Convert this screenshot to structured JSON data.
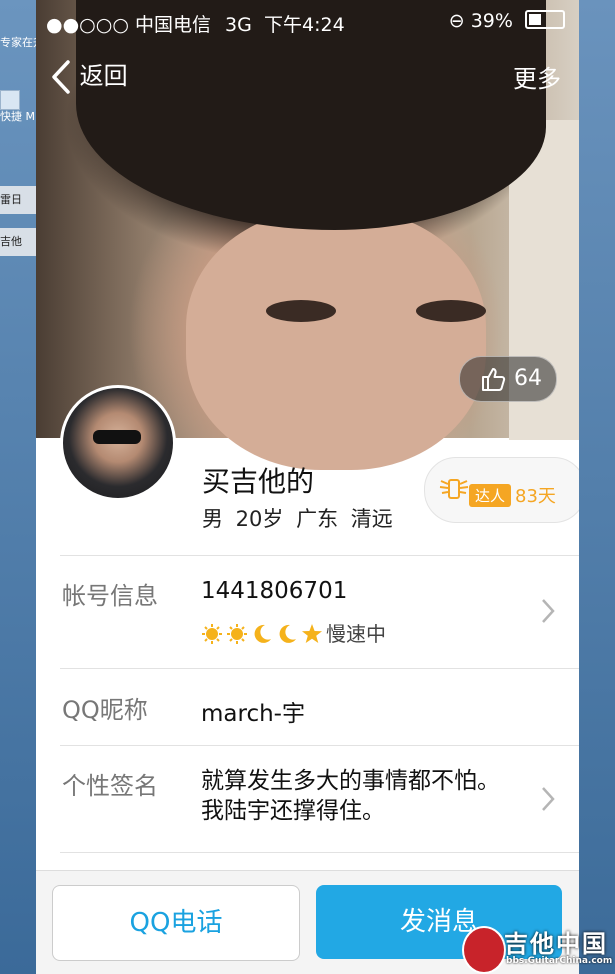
{
  "desktop": {
    "icons": [
      {
        "label": "专家在升级"
      },
      {
        "label": "快捷 Microsof..."
      }
    ],
    "taskbar": [
      {
        "label": "雷日"
      },
      {
        "label": "吉他"
      }
    ]
  },
  "status_bar": {
    "signal": "●●○○○",
    "carrier": "中国电信",
    "network": "3G",
    "time": "下午4:24",
    "battery_percent": "39%",
    "battery_level": 0.39
  },
  "nav": {
    "back_label": "返回",
    "more_label": "更多"
  },
  "profile": {
    "likes": "64",
    "name": "买吉他的",
    "info": "男  20岁  广东 清远",
    "daren_badge": "达人",
    "daren_days": "83天"
  },
  "rows": {
    "account": {
      "label": "帐号信息",
      "value": "1441806701",
      "level_icons": [
        "sun-icon",
        "sun-icon",
        "moon-icon",
        "moon-icon",
        "star-icon"
      ],
      "speed": "慢速中"
    },
    "nickname": {
      "label": "QQ昵称",
      "value": "march-宇"
    },
    "signature": {
      "label": "个性签名",
      "value": "就算发生多大的事情都不怕。我陆宇还撑得住。"
    }
  },
  "actions": {
    "call_label": "QQ电话",
    "message_label": "发消息"
  },
  "watermark": {
    "title": "吉他中国",
    "url": "bbs.GuitarChina.com"
  },
  "colors": {
    "accent": "#22a8e4",
    "daren": "#f5a623"
  }
}
